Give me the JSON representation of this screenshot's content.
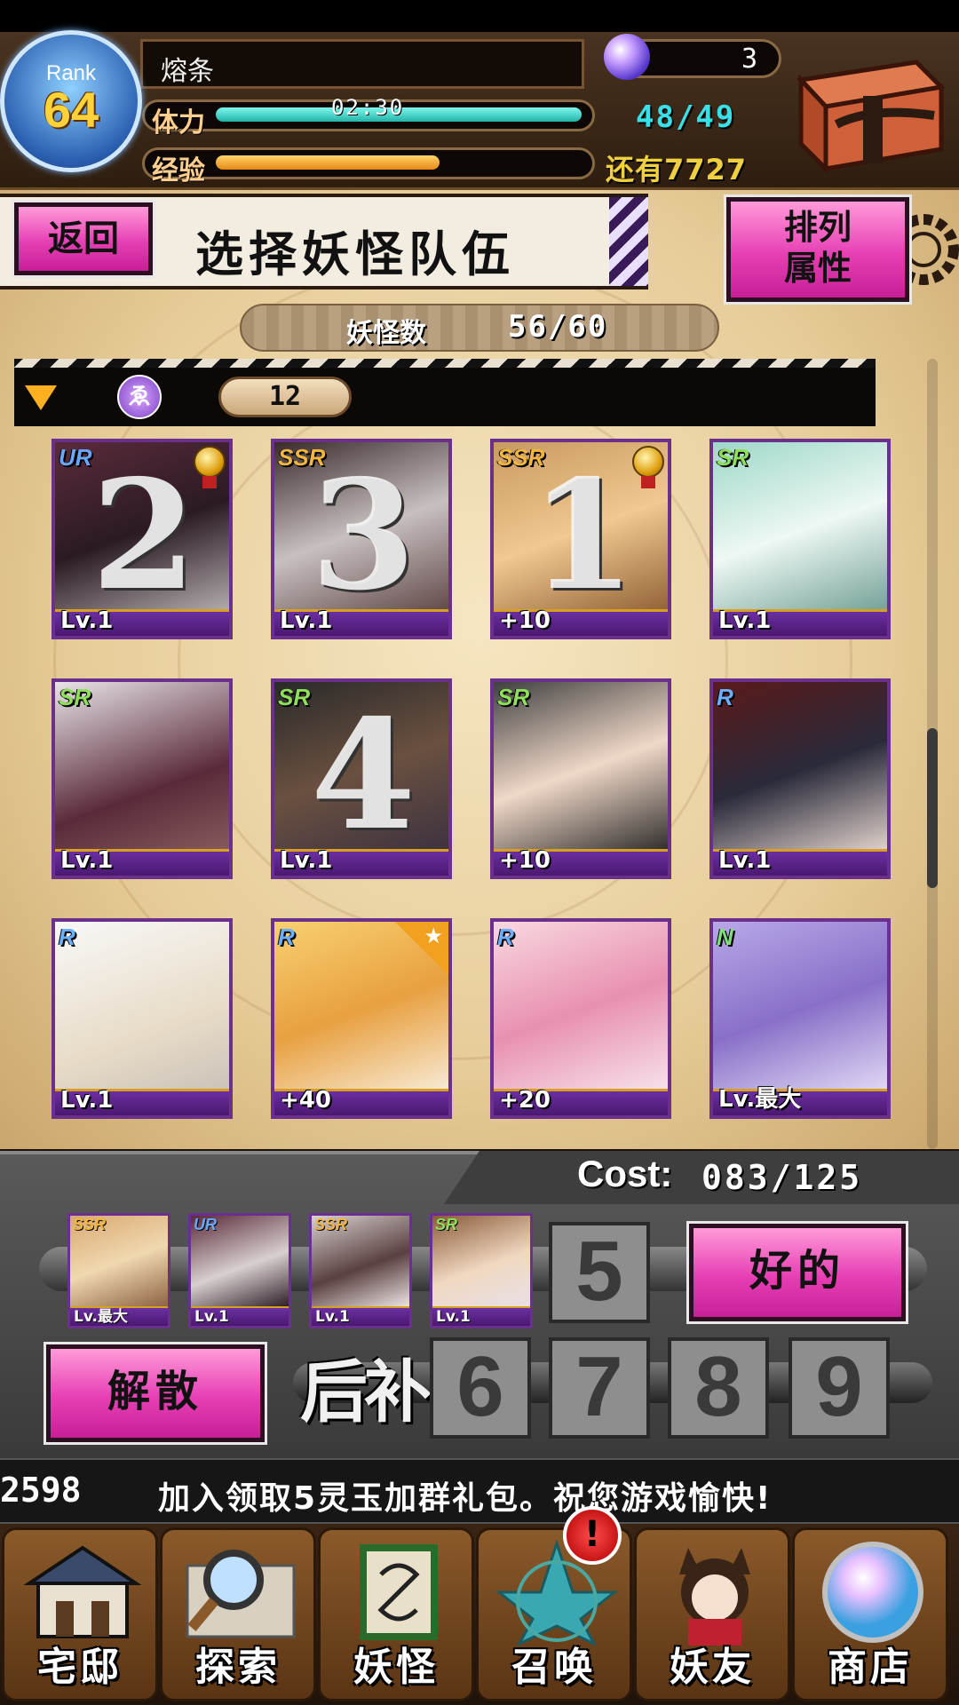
{
  "header": {
    "rank_label": "Rank",
    "rank_value": "64",
    "player_name": "熔条",
    "gem_count": "3",
    "stamina_label": "体力",
    "stamina_timer": "02:30",
    "stamina_value": "48/49",
    "stamina_fraction": 0.98,
    "exp_label": "经验",
    "exp_remaining": "还有7727",
    "exp_fraction": 0.6
  },
  "titlebar": {
    "back_label": "返回",
    "title": "选择妖怪队伍",
    "sort_line1": "排列",
    "sort_line2": "属性"
  },
  "counter": {
    "label": "妖怪数",
    "value": "56/60"
  },
  "group": {
    "count": "12",
    "icon": "purple-attribute-icon"
  },
  "cards": [
    {
      "rarity": "UR",
      "level": "Lv.1",
      "team_number": "2",
      "medal": true
    },
    {
      "rarity": "SSR",
      "level": "Lv.1",
      "team_number": "3",
      "medal": false
    },
    {
      "rarity": "SSR",
      "level": "+10",
      "team_number": "1",
      "medal": true
    },
    {
      "rarity": "SR",
      "level": "Lv.1",
      "team_number": "",
      "medal": false
    },
    {
      "rarity": "SR",
      "level": "Lv.1",
      "team_number": "",
      "medal": false
    },
    {
      "rarity": "SR",
      "level": "Lv.1",
      "team_number": "4",
      "medal": false
    },
    {
      "rarity": "SR",
      "level": "+10",
      "team_number": "",
      "medal": false
    },
    {
      "rarity": "R",
      "level": "Lv.1",
      "team_number": "",
      "medal": false
    },
    {
      "rarity": "R",
      "level": "Lv.1",
      "team_number": "",
      "medal": false
    },
    {
      "rarity": "R",
      "level": "+40",
      "team_number": "",
      "medal": false,
      "star": "★"
    },
    {
      "rarity": "R",
      "level": "+20",
      "team_number": "",
      "medal": false
    },
    {
      "rarity": "N",
      "level": "Lv.最大",
      "team_number": "",
      "medal": false
    }
  ],
  "team": {
    "cost_label": "Cost:",
    "cost_value": "083/125",
    "members": [
      {
        "rarity": "SSR",
        "level": "Lv.最大"
      },
      {
        "rarity": "UR",
        "level": "Lv.1"
      },
      {
        "rarity": "SSR",
        "level": "Lv.1"
      },
      {
        "rarity": "SR",
        "level": "Lv.1"
      }
    ],
    "empty_slot": "5",
    "bench_label": "后补",
    "bench_slots": [
      "6",
      "7",
      "8",
      "9"
    ],
    "ok_label": "好的",
    "disband_label": "解散"
  },
  "ticker": {
    "id": "2598",
    "message": "加入领取5灵玉加群礼包。祝您游戏愉快!"
  },
  "nav": [
    {
      "label": "宅邸",
      "icon": "mansion-icon"
    },
    {
      "label": "探索",
      "icon": "magnifier-map-icon"
    },
    {
      "label": "妖怪",
      "icon": "scroll-icon"
    },
    {
      "label": "召唤",
      "icon": "pentagram-icon"
    },
    {
      "label": "妖友",
      "icon": "catgirl-friend-icon"
    },
    {
      "label": "商店",
      "icon": "crystal-orb-icon"
    }
  ],
  "notification": "!",
  "colors": {
    "rarity": {
      "UR": "#6aa8ff",
      "SSR": "#f2b640",
      "SR": "#8ee05a",
      "R": "#6ab0ff",
      "N": "#7de07d"
    },
    "accent_pink": "#e63fb4",
    "card_border": "#6b2f8e"
  }
}
